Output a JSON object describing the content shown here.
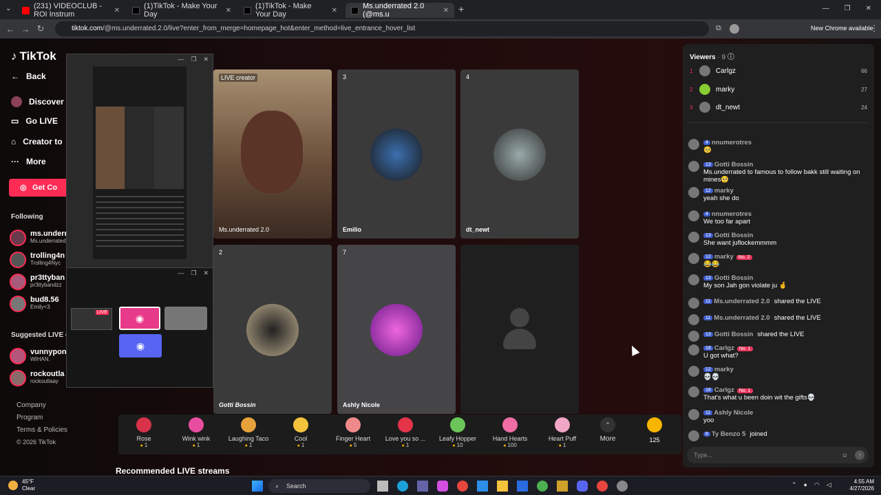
{
  "tabs": [
    {
      "title": "(231) VIDEOCLUB - ROI Instrum",
      "color": "#ff0000"
    },
    {
      "title": "(1)TikTok - Make Your Day",
      "color": "#111"
    },
    {
      "title": "(1)TikTok - Make Your Day",
      "color": "#111"
    },
    {
      "title": "Ms.underrated 2.0 (@ms.u",
      "color": "#111"
    }
  ],
  "url": {
    "domain": "tiktok.com",
    "path": "/@ms.underrated.2.0/live?enter_from_merge=homepage_hot&enter_method=live_entrance_hover_list"
  },
  "browser": {
    "new_chrome": "New Chrome available"
  },
  "sidebar": {
    "logo": "TikTok",
    "back": "Back",
    "discover": "Discover L",
    "go_live": "Go LIVE",
    "creator": "Creator to",
    "more": "More",
    "get_coins": "Get Co",
    "following_title": "Following",
    "following": [
      {
        "name": "ms.underr",
        "handle": "Ms.underrated"
      },
      {
        "name": "trolling4n",
        "handle": "Trolling4Nyc"
      },
      {
        "name": "pr3ttyban",
        "handle": "pr3ttybandzz"
      },
      {
        "name": "bud8.56",
        "handle": "Emily<3"
      }
    ],
    "suggested_title": "Suggested LIVE cr",
    "suggested": [
      {
        "name": "vunnypon",
        "handle": "WIHAN."
      },
      {
        "name": "rockoutla",
        "handle": "rockoutlaay"
      }
    ],
    "footer": [
      "Company",
      "Program",
      "Terms & Policies",
      "© 2026 TikTok"
    ]
  },
  "tiles": [
    {
      "num": "LIVE creator",
      "name": "Ms.underrated 2.0"
    },
    {
      "num": "3",
      "name": "Emilio"
    },
    {
      "num": "4",
      "name": "dt_newt"
    },
    {
      "num": "2",
      "name": "Gotti Bossin"
    },
    {
      "num": "7",
      "name": "Ashly Nicole"
    },
    {
      "num": "",
      "name": ""
    }
  ],
  "popup": {
    "live": "LIVE"
  },
  "gifts": [
    {
      "name": "Rose",
      "price": "1",
      "color": "#d8324a"
    },
    {
      "name": "Wink wink",
      "price": "1",
      "color": "#e94da0"
    },
    {
      "name": "Laughing Taco",
      "price": "1",
      "color": "#e8a23c"
    },
    {
      "name": "Cool",
      "price": "1",
      "color": "#f3c33c"
    },
    {
      "name": "Finger Heart",
      "price": "5",
      "color": "#f08a8a"
    },
    {
      "name": "Love you so ...",
      "price": "1",
      "color": "#e3344a"
    },
    {
      "name": "Leafy Hopper",
      "price": "10",
      "color": "#6bc55a"
    },
    {
      "name": "Hand Hearts",
      "price": "100",
      "color": "#ef6ca5"
    },
    {
      "name": "Heart Puff",
      "price": "1",
      "color": "#f2a6c6"
    }
  ],
  "gift_more": "More",
  "coins": "125",
  "recommended": "Recommended LIVE streams",
  "viewers": {
    "title": "Viewers",
    "count": "· 9",
    "top": [
      {
        "rank": "1",
        "name": "Carlgz",
        "score": "66"
      },
      {
        "rank": "2",
        "name": "marky",
        "score": "27"
      },
      {
        "rank": "3",
        "name": "dt_newt",
        "score": "24"
      }
    ]
  },
  "chat": [
    {
      "lv": "4",
      "user": "nnumerotres",
      "text": "🥺"
    },
    {
      "lv": "13",
      "user": "Gotti Bossin",
      "text": "Ms.underrated to famous to follow bakk still waiting on mines🥺"
    },
    {
      "lv": "12",
      "user": "marky",
      "text": "yeah she do"
    },
    {
      "lv": "4",
      "user": "nnumerotres",
      "text": "We too far apart"
    },
    {
      "lv": "13",
      "user": "Gotti Bossin",
      "text": "She want juflockemmmm"
    },
    {
      "lv": "12",
      "user": "marky",
      "badge": "No. 2",
      "text": "😂😂"
    },
    {
      "lv": "13",
      "user": "Gotti Bossin",
      "text": "My son Jah gon violate ju 🤞"
    },
    {
      "lv": "11",
      "user": "Ms.underrated 2.0",
      "text": "shared the LIVE",
      "inline": true
    },
    {
      "lv": "11",
      "user": "Ms.underrated 2.0",
      "text": "shared the LIVE",
      "inline": true
    },
    {
      "lv": "13",
      "user": "Gotti Bossin",
      "text": "shared the LIVE",
      "inline": true
    },
    {
      "lv": "18",
      "user": "Carlgz",
      "badge": "No. 1",
      "text": "U got what?"
    },
    {
      "lv": "12",
      "user": "marky",
      "text": "💀💀"
    },
    {
      "lv": "18",
      "user": "Carlgz",
      "badge": "No. 1",
      "text": "That's what u been doin wit the gifts💀"
    },
    {
      "lv": "11",
      "user": "Ashly Nicole",
      "text": "yoo"
    },
    {
      "lv": "8",
      "user": "Ty Benzo 5",
      "text": "joined",
      "inline": true
    }
  ],
  "chat_placeholder": "Type...",
  "taskbar": {
    "weather_temp": "45°F",
    "weather_desc": "Clear",
    "search": "Search",
    "time": "4:55 AM",
    "date": "4/27/2026"
  }
}
